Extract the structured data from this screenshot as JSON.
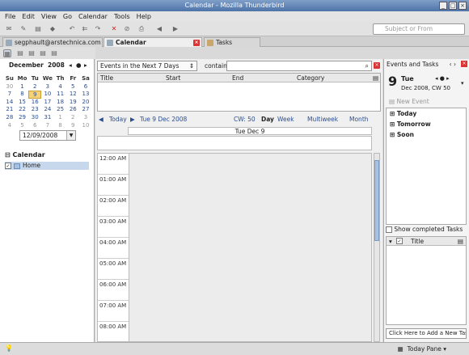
{
  "window": {
    "title": "Calendar - Mozilla Thunderbird"
  },
  "menu": [
    "File",
    "Edit",
    "View",
    "Go",
    "Calendar",
    "Tools",
    "Help"
  ],
  "toolbar": {
    "search_placeholder": "Subject or From"
  },
  "tabs": [
    {
      "label": "segphault@arstechnica.com"
    },
    {
      "label": "Calendar"
    },
    {
      "label": "Tasks"
    }
  ],
  "minical": {
    "month": "December",
    "year": "2008",
    "dow": [
      "Su",
      "Mo",
      "Tu",
      "We",
      "Th",
      "Fr",
      "Sa"
    ],
    "weeks": [
      [
        "30",
        "1",
        "2",
        "3",
        "4",
        "5",
        "6"
      ],
      [
        "7",
        "8",
        "9",
        "10",
        "11",
        "12",
        "13"
      ],
      [
        "14",
        "15",
        "16",
        "17",
        "18",
        "19",
        "20"
      ],
      [
        "21",
        "22",
        "23",
        "24",
        "25",
        "26",
        "27"
      ],
      [
        "28",
        "29",
        "30",
        "31",
        "1",
        "2",
        "3"
      ],
      [
        "4",
        "5",
        "6",
        "7",
        "8",
        "9",
        "10"
      ]
    ],
    "date_value": "12/09/2008"
  },
  "calendars": {
    "section": "Calendar",
    "items": [
      "Home"
    ]
  },
  "filter": {
    "select": "Events in the Next 7 Days",
    "contain_label": "contain"
  },
  "unifinder_cols": [
    "Title",
    "Start",
    "End",
    "Category"
  ],
  "nav": {
    "today": "Today",
    "current": "Tue 9 Dec 2008",
    "cw": "CW: 50",
    "views": [
      "Day",
      "Week",
      "Multiweek",
      "Month"
    ]
  },
  "day_header": "Tue Dec 9",
  "hours": [
    "12:00 AM",
    "01:00 AM",
    "02:00 AM",
    "03:00 AM",
    "04:00 AM",
    "05:00 AM",
    "06:00 AM",
    "07:00 AM",
    "08:00 AM"
  ],
  "today_pane": {
    "header": "Events and Tasks",
    "day_num": "9",
    "dow": "Tue",
    "sub": "Dec 2008, CW 50",
    "new_event": "New Event",
    "agenda": [
      "Today",
      "Tomorrow",
      "Soon"
    ],
    "show_completed": "Show completed Tasks",
    "task_col": "Title",
    "new_task": "Click Here to Add a New Task"
  },
  "status": {
    "today_pane": "Today Pane"
  }
}
